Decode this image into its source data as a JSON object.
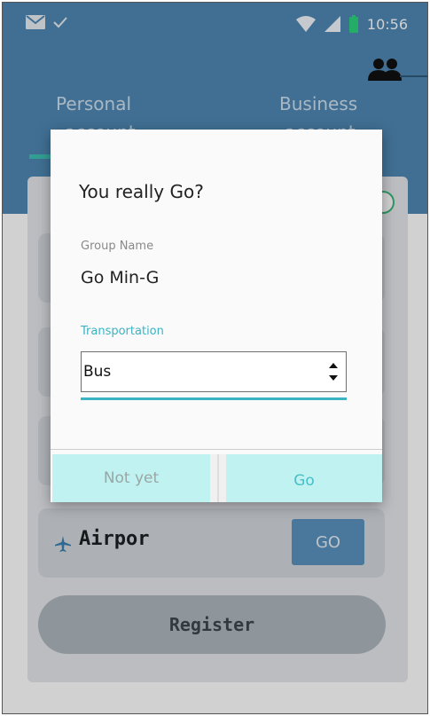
{
  "status_bar": {
    "time": "10:56",
    "icons": [
      "mail-icon",
      "check-icon",
      "wifi-icon",
      "signal-icon",
      "battery-icon"
    ]
  },
  "header": {
    "people_icon": "group-icon",
    "tabs": [
      {
        "label": "Personal",
        "label_cut": "account"
      },
      {
        "label": "Business",
        "label_cut": "account"
      }
    ]
  },
  "background": {
    "airport_label": "Airpor",
    "go_label": "GO",
    "register_label": "Register"
  },
  "dialog": {
    "title": "You really Go?",
    "group_label": "Group Name",
    "group_value": "Go Min-G",
    "transport_label": "Transportation",
    "transport_value": "Bus",
    "cancel_label": "Not yet",
    "confirm_label": "Go"
  },
  "colors": {
    "header": "#4f88b4",
    "accent": "#3bb3c3",
    "dialog_button": "#bff2f0",
    "tab_indicator": "#3fc3b2"
  }
}
